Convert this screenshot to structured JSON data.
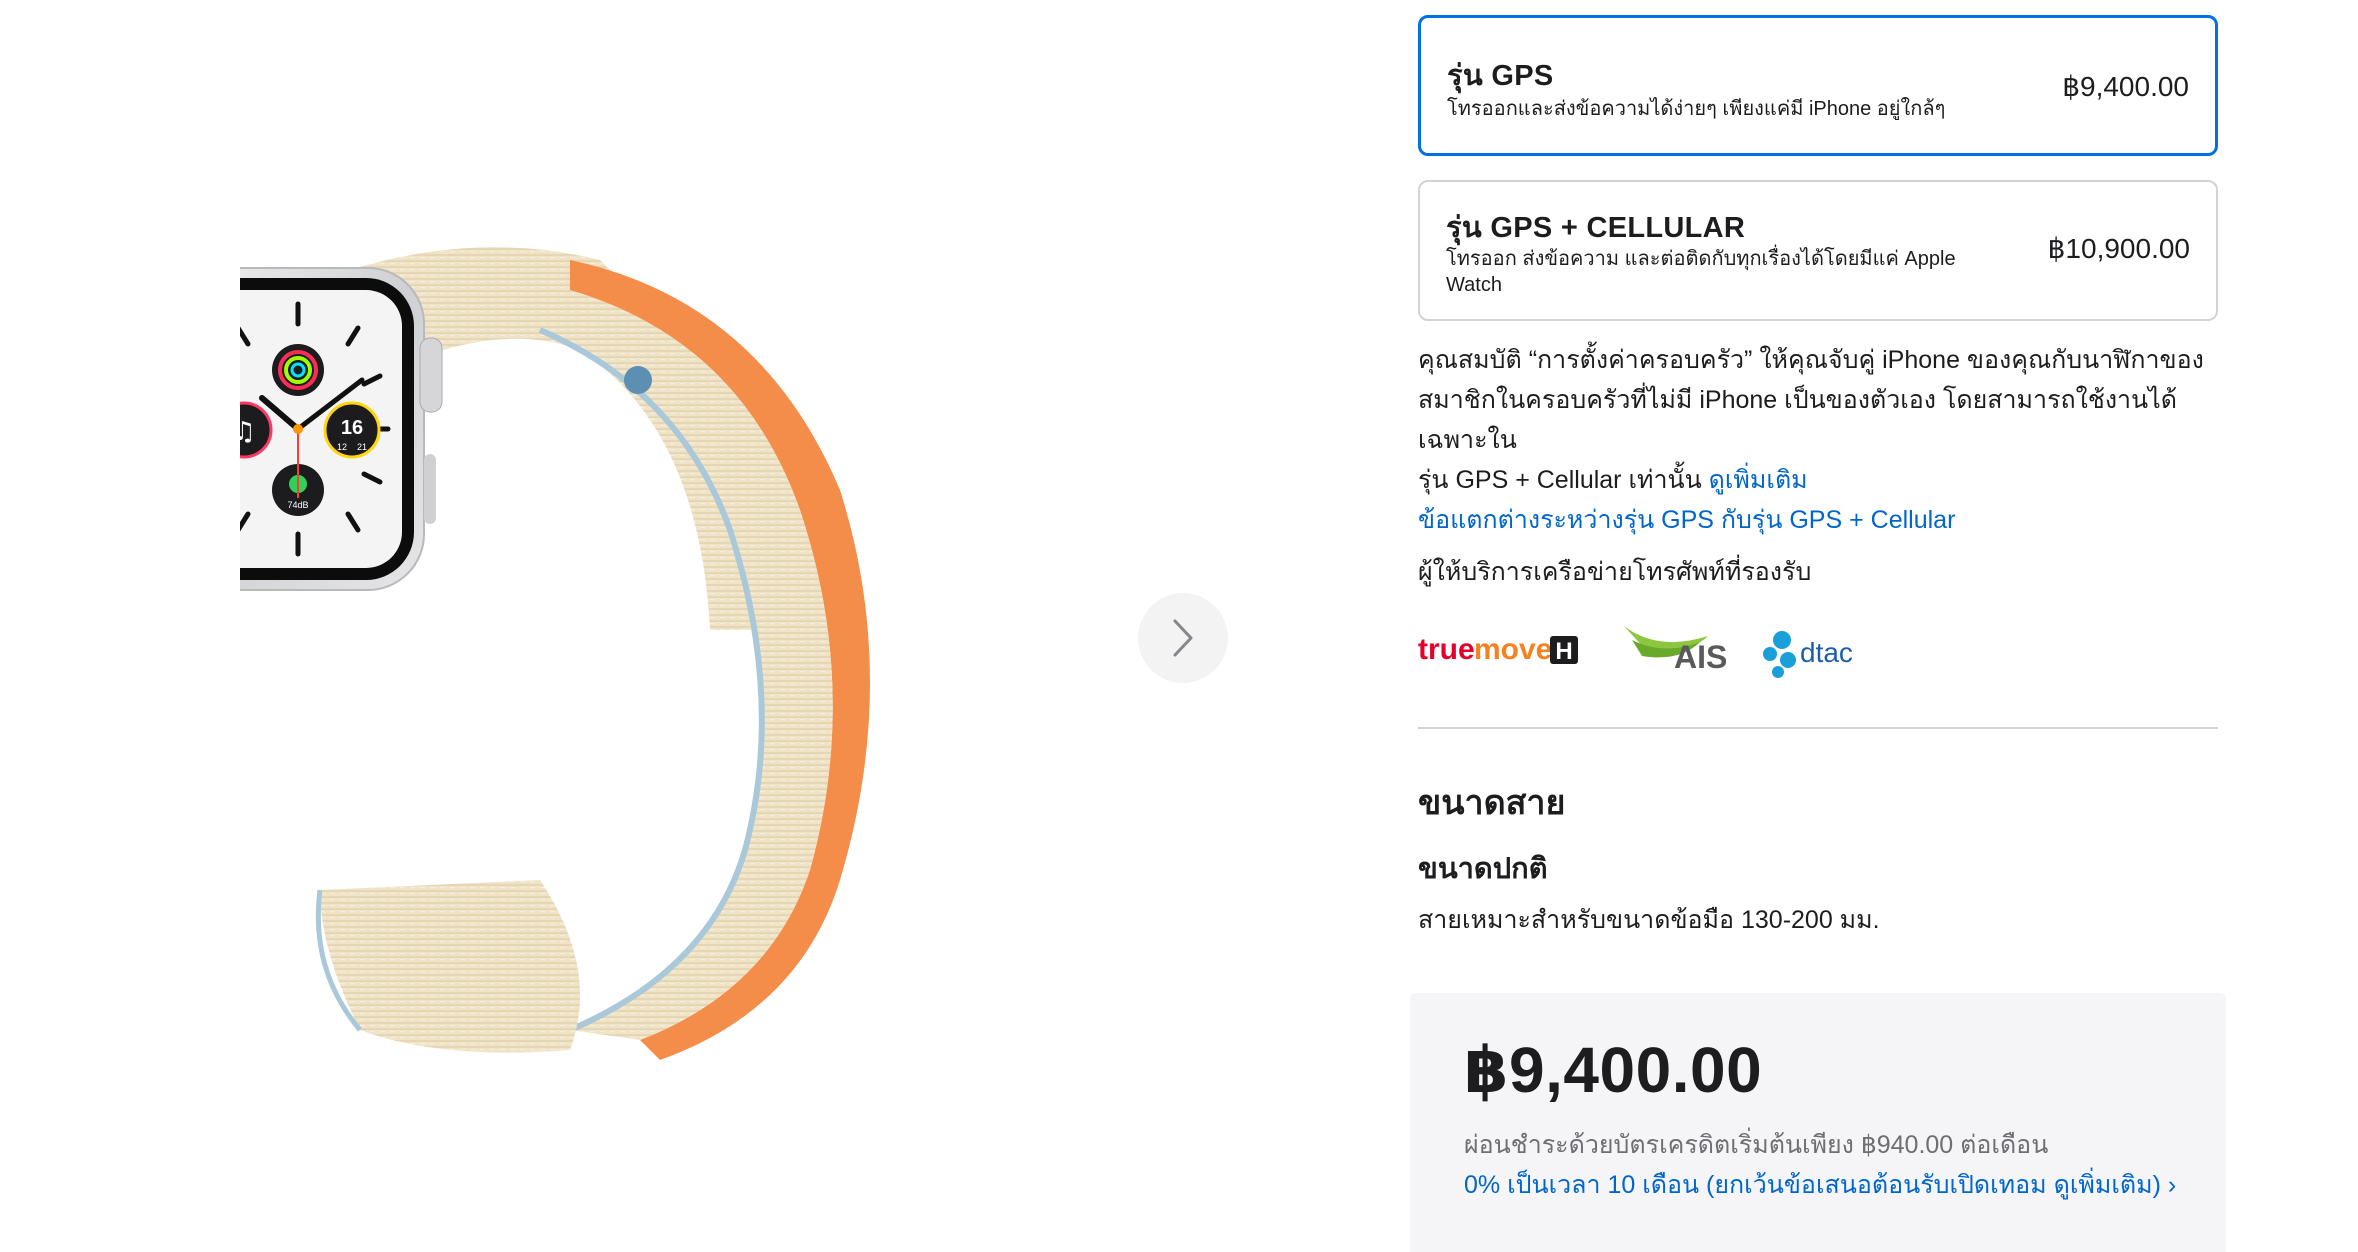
{
  "gallery": {
    "product_image_alt": "Apple Watch SE silver aluminum case with cream sport loop",
    "watch_face": {
      "date": "16",
      "numbers": [
        "12",
        "21"
      ],
      "noise_level": "74dB"
    },
    "next_icon": "chevron-right-icon"
  },
  "models": [
    {
      "name": "รุ่น GPS",
      "description": "โทรออกและส่งข้อความได้ง่ายๆ เพียงแค่มี iPhone อยู่ใกล้ๆ",
      "price": "฿9,400.00",
      "selected": true
    },
    {
      "name": "รุ่น GPS + CELLULAR",
      "description_line1": "โทรออก ส่งข้อความ และต่อติดกับทุกเรื่องได้โดยมีแค่ Apple",
      "description_line2": "Watch",
      "price": "฿10,900.00",
      "selected": false
    }
  ],
  "family_setup": {
    "line1": "คุณสมบัติ “การตั้งค่าครอบครัว” ให้คุณจับคู่ iPhone ของคุณกับนาฬิกาของ",
    "line2": "สมาชิกในครอบครัวที่ไม่มี iPhone เป็นของตัวเอง โดยสามารถใช้งานได้เฉพาะใน",
    "line3": "รุ่น GPS + Cellular เท่านั้น",
    "learn_more": "ดูเพิ่มเติม",
    "compare_link": "ข้อแตกต่างระหว่างรุ่น GPS กับรุ่น GPS + Cellular"
  },
  "carriers": {
    "title": "ผู้ให้บริการเครือข่ายโทรศัพท์ที่รองรับ",
    "truemove_part1": "true",
    "truemove_part2": "move",
    "truemove_badge": "H",
    "ais": "AIS",
    "dtac": "dtac"
  },
  "band": {
    "heading": "ขนาดสาย",
    "size_name": "ขนาดปกติ",
    "size_desc": "สายเหมาะสำหรับขนาดข้อมือ 130-200 มม."
  },
  "summary": {
    "price": "฿9,400.00",
    "installment": "ผ่อนชำระด้วยบัตรเครดิตเริ่มต้นเพียง ฿940.00 ต่อเดือน",
    "installment_link": "0% เป็นเวลา 10 เดือน (ยกเว้นข้อเสนอต้อนรับเปิดเทอม ดูเพิ่มเติม) ›"
  },
  "colors": {
    "accent": "#0071e3",
    "link": "#0066cc",
    "text": "#1d1d1f",
    "secondary_text": "#6e6e73",
    "border": "#d2d2d7",
    "price_box_bg": "#f5f5f7"
  }
}
